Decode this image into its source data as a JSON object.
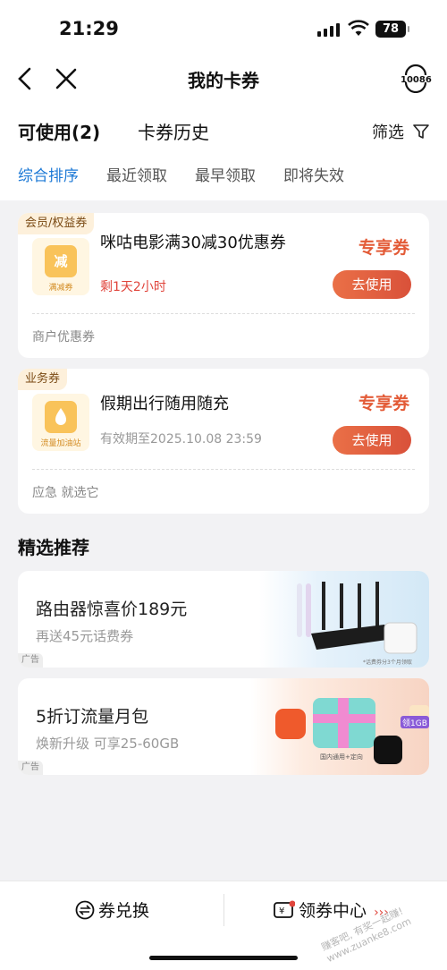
{
  "status": {
    "time": "21:29",
    "battery": "78"
  },
  "nav": {
    "title": "我的卡券",
    "service_number": "10086"
  },
  "tabs": {
    "available": "可使用(2)",
    "history": "卡券历史",
    "filter": "筛选"
  },
  "sorts": [
    "综合排序",
    "最近领取",
    "最早领取",
    "即将失效"
  ],
  "coupons": [
    {
      "tag": "会员/权益券",
      "icon_text": "减",
      "icon_caption": "满减券",
      "title": "咪咕电影满30减30优惠券",
      "subtitle": "剩1天2小时",
      "subtitle_color": "#e0453c",
      "badge": "专享券",
      "button": "去使用",
      "footer": "商户优惠券"
    },
    {
      "tag": "业务券",
      "icon_text": "",
      "icon_caption": "流量加油站",
      "title": "假期出行随用随充",
      "subtitle": "有效期至2025.10.08 23:59",
      "subtitle_color": "#999999",
      "badge": "专享券",
      "button": "去使用",
      "footer": "应急 就选它"
    }
  ],
  "recommend": {
    "title": "精选推荐",
    "items": [
      {
        "title": "路由器惊喜价189元",
        "subtitle": "再送45元话费券",
        "ad": "广告",
        "img_caption": "*话费券分3个月领取"
      },
      {
        "title": "5折订流量月包",
        "subtitle": "焕新升级 可享25-60GB",
        "ad": "广告",
        "img_caption": "国内通用+定向",
        "img_badge": "领1GB"
      }
    ]
  },
  "bottom": {
    "exchange": "券兑换",
    "center": "领券中心"
  },
  "watermark": "赚客吧, 有奖一起赚! www.zuanke8.com",
  "colors": {
    "accent_blue": "#1e7ad6",
    "coupon_red": "#e35b37",
    "button_orange": "#e0603f"
  }
}
